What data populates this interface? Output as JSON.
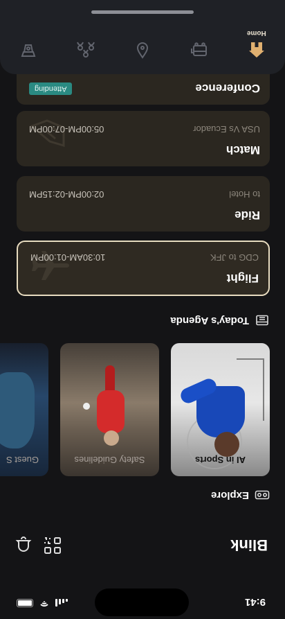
{
  "status": {
    "time": "9:41"
  },
  "app": {
    "title": "Blink"
  },
  "sections": {
    "explore": "Explore",
    "agenda": "Today's Agenda"
  },
  "explore_cards": [
    {
      "caption": "AI in Sports"
    },
    {
      "caption": "Safety Guidelines"
    },
    {
      "caption": "Guest S"
    }
  ],
  "agenda": [
    {
      "title": "Flight",
      "sub": "CDG to JFK",
      "time": "10:30AM-01:00PM",
      "icon": "airplane-icon"
    },
    {
      "title": "Ride",
      "sub": "to Hotel",
      "time": "02:00PM-02:15PM",
      "icon": ""
    },
    {
      "title": "Match",
      "sub": "USA Vs Ecuador",
      "time": "05:00PM-07:00PM",
      "icon": "stadium-icon"
    },
    {
      "title": "Conference",
      "badge": "Attending"
    }
  ],
  "nav": {
    "home": "Home",
    "selected": "home"
  },
  "colors": {
    "accent": "#e0b070",
    "active_border": "#e8dcc0",
    "badge": "#2a8a82",
    "card_bg": "#2b2720"
  }
}
